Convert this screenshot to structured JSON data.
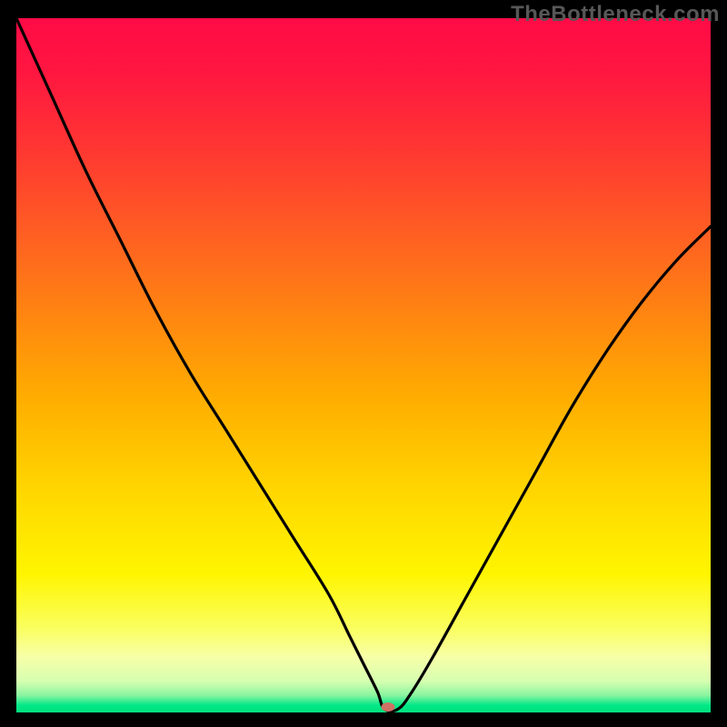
{
  "watermark": "TheBottleneck.com",
  "chart_data": {
    "type": "line",
    "title": "",
    "xlabel": "",
    "ylabel": "",
    "xlim": [
      0,
      100
    ],
    "ylim": [
      0,
      100
    ],
    "grid": false,
    "legend": false,
    "curve": {
      "description": "V-shaped bottleneck curve with minimum near x≈53",
      "x": [
        0,
        5,
        10,
        15,
        20,
        25,
        30,
        35,
        40,
        45,
        48,
        50,
        52,
        53,
        55,
        57,
        60,
        65,
        70,
        75,
        80,
        85,
        90,
        95,
        100
      ],
      "y": [
        100,
        89,
        78,
        68,
        58,
        49,
        41,
        33,
        25,
        17,
        11,
        7,
        3,
        0.5,
        0.5,
        3,
        8,
        17,
        26,
        35,
        44,
        52,
        59,
        65,
        70
      ]
    },
    "flat_region_x": [
      49.5,
      55
    ],
    "marker": {
      "x": 53.5,
      "y": 0.8,
      "color": "#cf7165"
    },
    "gradient_stops": [
      {
        "offset": 0.0,
        "color": "#ff0b46"
      },
      {
        "offset": 0.08,
        "color": "#ff1740"
      },
      {
        "offset": 0.18,
        "color": "#ff3433"
      },
      {
        "offset": 0.3,
        "color": "#ff5b24"
      },
      {
        "offset": 0.42,
        "color": "#ff8312"
      },
      {
        "offset": 0.55,
        "color": "#ffae00"
      },
      {
        "offset": 0.68,
        "color": "#ffd600"
      },
      {
        "offset": 0.8,
        "color": "#fff500"
      },
      {
        "offset": 0.88,
        "color": "#faff61"
      },
      {
        "offset": 0.92,
        "color": "#f7ffa8"
      },
      {
        "offset": 0.955,
        "color": "#d6ffb0"
      },
      {
        "offset": 0.975,
        "color": "#8bf5a0"
      },
      {
        "offset": 0.99,
        "color": "#00e887"
      },
      {
        "offset": 1.0,
        "color": "#00e07d"
      }
    ]
  }
}
